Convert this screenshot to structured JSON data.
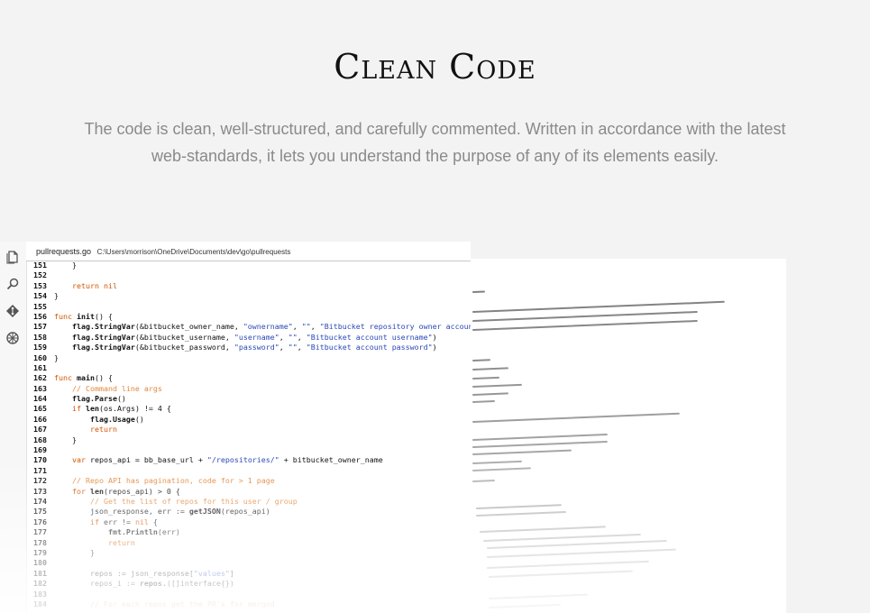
{
  "heading": {
    "title": "Clean Code",
    "subtitle": "The code is clean, well-structured, and carefully commented. Written in accordance with the latest web-standards, it lets you understand the purpose of any of its elements easily."
  },
  "editor": {
    "file_name": "pullrequests.go",
    "file_path": "C:\\Users\\morrison\\OneDrive\\Documents\\dev\\go\\pullrequests",
    "activity_icons": [
      "files-icon",
      "search-icon",
      "git-icon",
      "debug-icon"
    ],
    "lines": [
      {
        "n": "151",
        "code": "    }"
      },
      {
        "n": "152",
        "code": ""
      },
      {
        "n": "153",
        "code": "    return nil"
      },
      {
        "n": "154",
        "code": "}"
      },
      {
        "n": "155",
        "code": ""
      },
      {
        "n": "156",
        "code": "func init() {"
      },
      {
        "n": "157",
        "code": "    flag.StringVar(&bitbucket_owner_name, \"ownername\", \"\", \"Bitbucket repository owner account\")"
      },
      {
        "n": "158",
        "code": "    flag.StringVar(&bitbucket_username, \"username\", \"\", \"Bitbucket account username\")"
      },
      {
        "n": "159",
        "code": "    flag.StringVar(&bitbucket_password, \"password\", \"\", \"Bitbucket account password\")"
      },
      {
        "n": "160",
        "code": "}"
      },
      {
        "n": "161",
        "code": ""
      },
      {
        "n": "162",
        "code": "func main() {"
      },
      {
        "n": "163",
        "code": "    // Command line args"
      },
      {
        "n": "164",
        "code": "    flag.Parse()"
      },
      {
        "n": "165",
        "code": "    if len(os.Args) != 4 {"
      },
      {
        "n": "166",
        "code": "        flag.Usage()"
      },
      {
        "n": "167",
        "code": "        return"
      },
      {
        "n": "168",
        "code": "    }"
      },
      {
        "n": "169",
        "code": ""
      },
      {
        "n": "170",
        "code": "    var repos_api = bb_base_url + \"/repositories/\" + bitbucket_owner_name"
      },
      {
        "n": "171",
        "code": ""
      },
      {
        "n": "172",
        "code": "    // Repo API has pagination, code for > 1 page"
      },
      {
        "n": "173",
        "code": "    for len(repos_api) > 0 {"
      },
      {
        "n": "174",
        "code": "        // Get the list of repos for this user / group"
      },
      {
        "n": "175",
        "code": "        json_response, err := getJSON(repos_api)"
      },
      {
        "n": "176",
        "code": "        if err != nil {"
      },
      {
        "n": "177",
        "code": "            fmt.Println(err)"
      },
      {
        "n": "178",
        "code": "            return"
      },
      {
        "n": "179",
        "code": "        }"
      },
      {
        "n": "180",
        "code": ""
      },
      {
        "n": "181",
        "code": "        repos := json_response[\"values\"]"
      },
      {
        "n": "182",
        "code": "        repos_i := repos.([]interface{})"
      },
      {
        "n": "183",
        "code": ""
      },
      {
        "n": "184",
        "code": "        // For each repos get the PR's for merged"
      }
    ]
  },
  "colors": {
    "background": "#f3f3f3",
    "keyword": "#d35400",
    "string": "#2b47b8",
    "comment": "#d9690a",
    "subtitle": "#8a8a8a"
  }
}
